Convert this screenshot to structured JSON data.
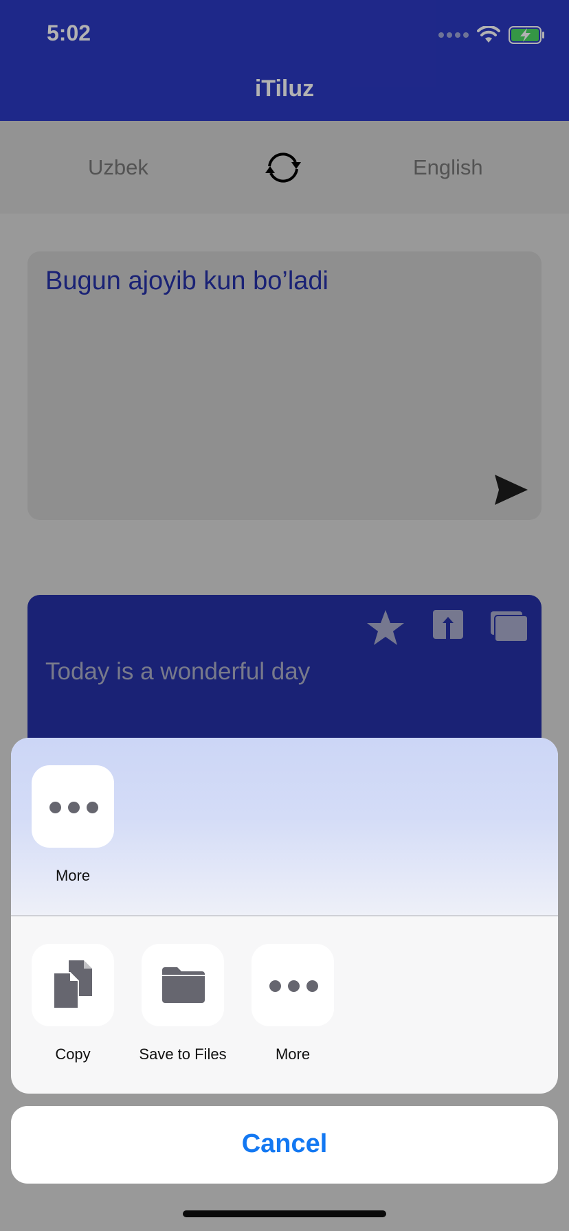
{
  "status_bar": {
    "time": "5:02"
  },
  "app": {
    "title": "iTiluz",
    "source_language": "Uzbek",
    "target_language": "English",
    "input_text": "Bugun ajoyib kun bo’ladi",
    "output_text": "Today is a wonderful day",
    "icons": {
      "swap": "swap-languages-icon",
      "send": "send-icon",
      "favorite": "star-icon",
      "share": "share-icon",
      "copy": "copy-icon"
    }
  },
  "share_sheet": {
    "apps_row": [
      {
        "label": "More",
        "icon": "more-icon"
      }
    ],
    "actions_row": [
      {
        "label": "Copy",
        "icon": "copy-doc-icon"
      },
      {
        "label": "Save to Files",
        "icon": "folder-icon"
      },
      {
        "label": "More",
        "icon": "more-icon"
      }
    ],
    "cancel_label": "Cancel"
  },
  "colors": {
    "brand_blue": "#2c3ac4",
    "ios_blue": "#1378f2",
    "battery_green": "#4cd964"
  }
}
